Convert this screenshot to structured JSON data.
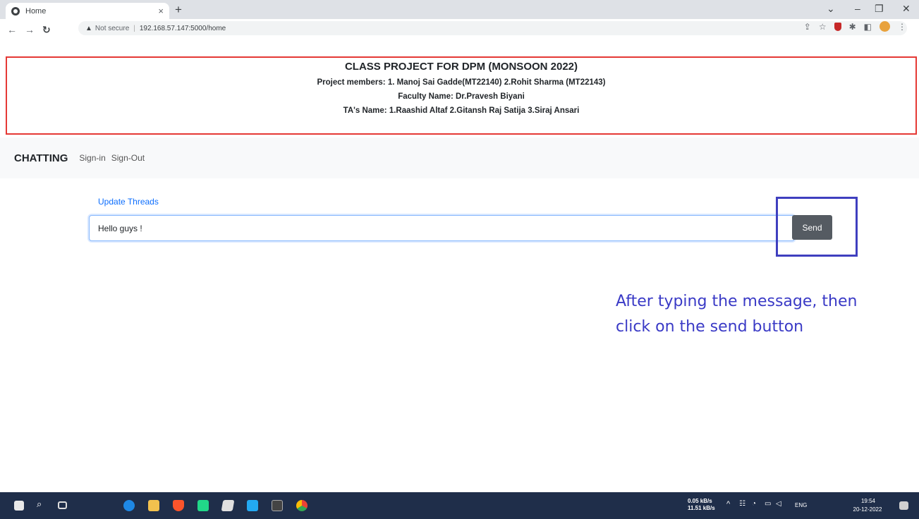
{
  "browser": {
    "tab_title": "Home",
    "tab_close": "×",
    "new_tab": "+",
    "security_label": "Not secure",
    "url": "192.168.57.147:5000/home"
  },
  "header": {
    "title": "CLASS PROJECT FOR DPM (MONSOON 2022)",
    "members": "Project members: 1. Manoj Sai Gadde(MT22140) 2.Rohit Sharma (MT22143)",
    "faculty": "Faculty Name: Dr.Pravesh Biyani",
    "tas": "TA's Name: 1.Raashid Altaf 2.Gitansh Raj Satija 3.Siraj Ansari"
  },
  "navbar": {
    "brand": "CHATTING",
    "links": [
      "Sign-in",
      "Sign-Out"
    ]
  },
  "chat": {
    "update_link": "Update Threads",
    "input_value": "Hello guys !",
    "send_label": "Send"
  },
  "annotation": {
    "text": "After typing the message, then click on the send button",
    "color": "#3a3ac6"
  },
  "taskbar": {
    "net_up": "0.05 kB/s",
    "net_down": "11.51 kB/s",
    "language": "ENG",
    "time": "19:54",
    "date": "20-12-2022"
  },
  "colors": {
    "accent_red": "#e53935",
    "highlight_box": "#3f3fbf",
    "send_button": "#555b62",
    "taskbar": "#1f2e4a"
  }
}
